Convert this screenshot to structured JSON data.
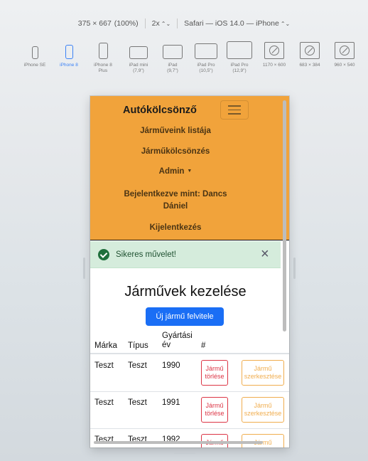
{
  "toolbar": {
    "dimensions": "375 × 667",
    "zoom": "(100%)",
    "scale": "2x",
    "browser": "Safari — iOS 14.0 — iPhone"
  },
  "devices": [
    {
      "label": "iPhone SE",
      "icon": "phone-icon"
    },
    {
      "label": "iPhone 8",
      "icon": "phone-icon",
      "active": true
    },
    {
      "label": "iPhone 8\nPlus",
      "icon": "phone-icon"
    },
    {
      "label": "iPad mini\n(7,9\")",
      "icon": "tablet-icon"
    },
    {
      "label": "iPad\n(9,7\")",
      "icon": "tablet-icon"
    },
    {
      "label": "iPad Pro\n(10,5\")",
      "icon": "tablet-icon"
    },
    {
      "label": "iPad Pro\n(12,9\")",
      "icon": "tablet-icon"
    },
    {
      "label": "1170 × 600",
      "icon": "compass-icon"
    },
    {
      "label": "683 × 384",
      "icon": "compass-icon"
    },
    {
      "label": "960 × 540",
      "icon": "compass-icon"
    }
  ],
  "app": {
    "brand": "Autókölcsönző",
    "nav": {
      "vehicle_list": "Járműveink listája",
      "vehicle_rental": "Járműkölcsönzés",
      "admin": "Admin",
      "logged_in_line1": "Bejelentkezve mint: Dancs",
      "logged_in_line2": "Dániel",
      "logout": "Kijelentkezés"
    },
    "alert": {
      "message": "Sikeres művelet!",
      "close": "×"
    },
    "page_title": "Járművek kezelése",
    "new_button": "Új jármű felvitele",
    "table": {
      "headers": {
        "brand": "Márka",
        "type": "Típus",
        "year_line1": "Gyártási",
        "year_line2": "év",
        "actions": "#"
      },
      "delete_line1": "Jármű",
      "delete_line2": "törlése",
      "edit_line1": "Jármű",
      "edit_line2": "szerkesztése",
      "rows": [
        {
          "brand": "Teszt",
          "type": "Teszt",
          "year": "1990"
        },
        {
          "brand": "Teszt",
          "type": "Teszt",
          "year": "1991"
        },
        {
          "brand": "Teszt",
          "type": "Teszt",
          "year": "1992"
        }
      ]
    }
  }
}
